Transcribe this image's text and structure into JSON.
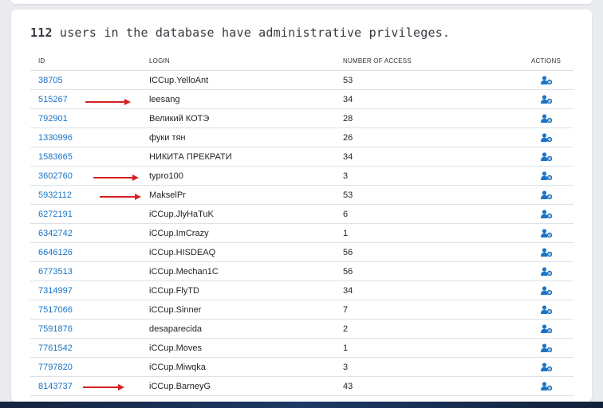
{
  "heading": {
    "count": "112",
    "text": " users in the database have administrative privileges."
  },
  "table": {
    "columns": [
      "ID",
      "LOGIN",
      "NUMBER OF ACCESS",
      "ACTIONS"
    ],
    "rows": [
      {
        "id": "38705",
        "login": "ICCup.YelloAnt",
        "access": "53"
      },
      {
        "id": "515267",
        "login": "leesang",
        "access": "34"
      },
      {
        "id": "792901",
        "login": "Великий КОТЭ",
        "access": "28"
      },
      {
        "id": "1330996",
        "login": "фуки тян",
        "access": "26"
      },
      {
        "id": "1583665",
        "login": "НИКИТА ПРЕКРАТИ",
        "access": "34"
      },
      {
        "id": "3602760",
        "login": "typro100",
        "access": "3"
      },
      {
        "id": "5932112",
        "login": "MakselPr",
        "access": "53"
      },
      {
        "id": "6272191",
        "login": "iCCup.JlyHaTuK",
        "access": "6"
      },
      {
        "id": "6342742",
        "login": "iCCup.ImCrazy",
        "access": "1"
      },
      {
        "id": "6646126",
        "login": "iCCup.HISDEAQ",
        "access": "56"
      },
      {
        "id": "6773513",
        "login": "iCCup.Mechan1C",
        "access": "56"
      },
      {
        "id": "7314997",
        "login": "iCCup.FlyTD",
        "access": "34"
      },
      {
        "id": "7517066",
        "login": "iCCup.Sinner",
        "access": "7"
      },
      {
        "id": "7591876",
        "login": "desaparecida",
        "access": "2"
      },
      {
        "id": "7761542",
        "login": "iCCup.Moves",
        "access": "1"
      },
      {
        "id": "7797820",
        "login": "iCCup.Miwqka",
        "access": "3"
      },
      {
        "id": "8143737",
        "login": "iCCup.BarneyG",
        "access": "43"
      }
    ]
  },
  "colors": {
    "link": "#1a73c4",
    "annotation_arrow": "#d42020"
  },
  "icons": {
    "action": "user-gear-icon",
    "cursor": "mouse-pointer-icon",
    "annotation": "red-arrow"
  }
}
